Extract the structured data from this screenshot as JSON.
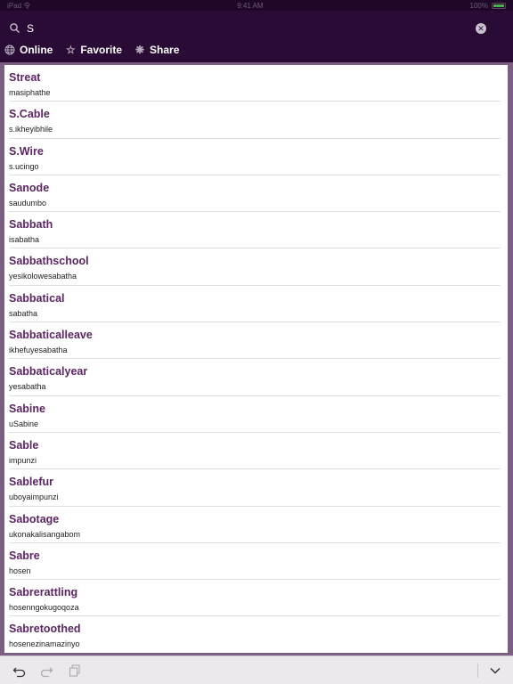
{
  "status_bar": {
    "left": "iPad 令",
    "time": "9:41 AM",
    "battery": "100%"
  },
  "search": {
    "value": "S",
    "placeholder": ""
  },
  "toolbar": {
    "online_label": "Online",
    "favorite_label": "Favorite",
    "share_label": "Share"
  },
  "colors": {
    "header_bg": "#2a0b35",
    "accent_word": "#5c2563",
    "frame": "#7b5f82"
  },
  "entries": [
    {
      "word": "Streat",
      "translation": "masiphathe"
    },
    {
      "word": "S.Cable",
      "translation": "s.ikheyibhile"
    },
    {
      "word": "S.Wire",
      "translation": "s.ucingo"
    },
    {
      "word": "Sanode",
      "translation": "saudumbo"
    },
    {
      "word": "Sabbath",
      "translation": "isabatha"
    },
    {
      "word": "Sabbathschool",
      "translation": "yesikolowesabatha"
    },
    {
      "word": "Sabbatical",
      "translation": "sabatha"
    },
    {
      "word": "Sabbaticalleave",
      "translation": "ikhefuyesabatha"
    },
    {
      "word": "Sabbaticalyear",
      "translation": "yesabatha"
    },
    {
      "word": "Sabine",
      "translation": "uSabine"
    },
    {
      "word": "Sable",
      "translation": "impunzi"
    },
    {
      "word": "Sablefur",
      "translation": "uboyaimpunzi"
    },
    {
      "word": "Sabotage",
      "translation": "ukonakalisangabom"
    },
    {
      "word": "Sabre",
      "translation": "hosen"
    },
    {
      "word": "Sabrerattling",
      "translation": "hosenngokugoqoza"
    },
    {
      "word": "Sabretoothed",
      "translation": "hosenezinamazinyo"
    }
  ]
}
